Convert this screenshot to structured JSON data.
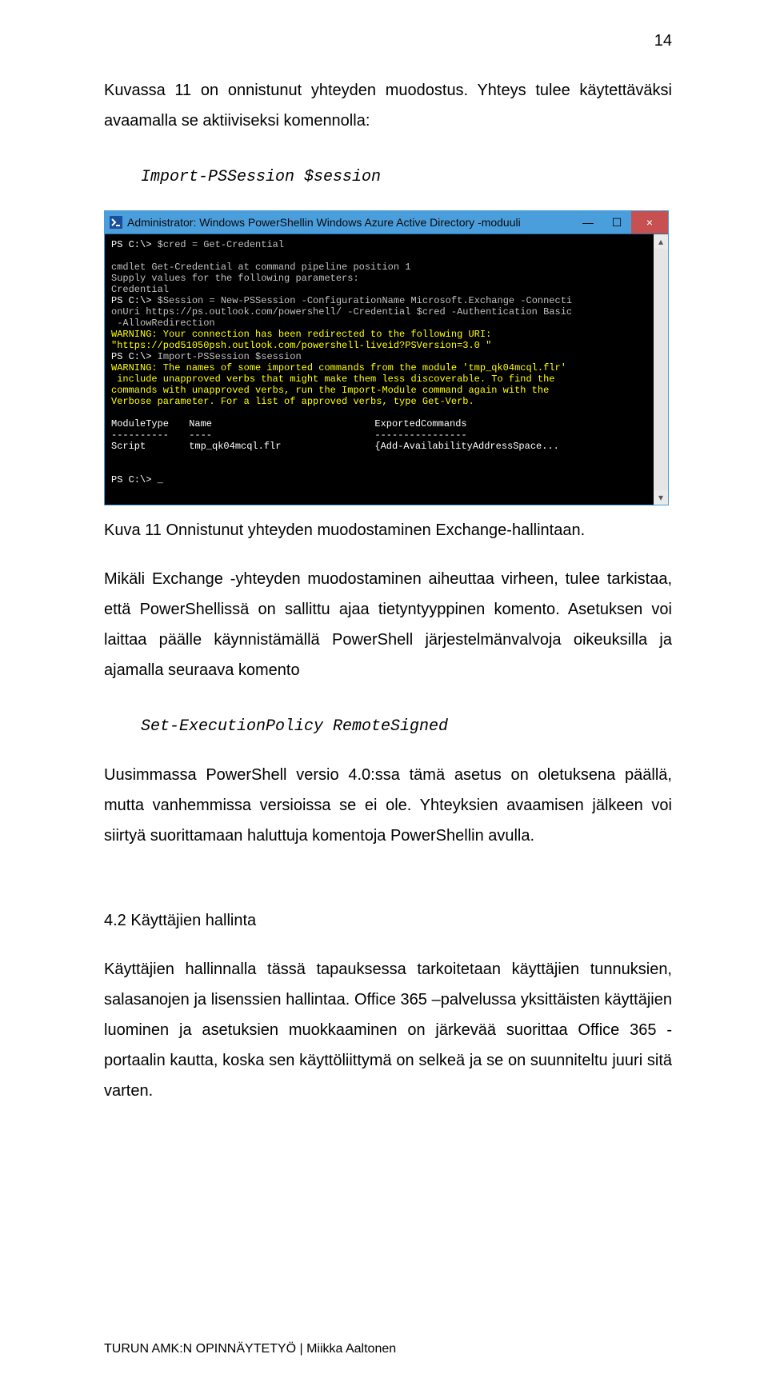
{
  "page_number": "14",
  "para1": "Kuvassa 11 on onnistunut yhteyden muodostus. Yhteys tulee käytettäväksi avaamalla se aktiiviseksi komennolla:",
  "code1": "Import-PSSession $session",
  "caption": "Kuva 11 Onnistunut yhteyden muodostaminen Exchange-hallintaan.",
  "para2": "Mikäli Exchange -yhteyden muodostaminen aiheuttaa virheen, tulee tarkistaa, että PowerShellissä on sallittu ajaa tietyntyyppinen komento. Asetuksen voi laittaa päälle käynnistämällä PowerShell järjestelmänvalvoja oikeuksilla ja ajamalla seuraava komento",
  "code2": "Set-ExecutionPolicy RemoteSigned",
  "para3": "Uusimmassa PowerShell versio 4.0:ssa tämä asetus on oletuksena päällä, mutta vanhemmissa versioissa se ei ole. Yhteyksien avaamisen jälkeen voi siirtyä suorittamaan haluttuja komentoja PowerShellin avulla.",
  "heading": "4.2 Käyttäjien hallinta",
  "para4": "Käyttäjien hallinnalla tässä tapauksessa tarkoitetaan käyttäjien tunnuksien, salasanojen ja lisenssien hallintaa. Office 365 –palvelussa yksittäisten käyttäjien luominen ja asetuksien muokkaaminen on järkevää suorittaa Office 365 -portaalin kautta, koska sen käyttöliittymä on selkeä ja se on suunniteltu juuri sitä varten.",
  "footer": "TURUN AMK:N OPINNÄYTETYÖ | Miikka Aaltonen",
  "terminal": {
    "title": "Administrator: Windows PowerShellin Windows Azure Active Directory -moduuli",
    "minimize": "—",
    "maximize": "☐",
    "close": "×",
    "sb_up": "▴",
    "sb_down": "▾",
    "l_prompt": "PS C:\\>",
    "l_cred": " $cred = Get-Credential",
    "l_cmdlet": "cmdlet Get-Credential at command pipeline position 1",
    "l_supply": "Supply values for the following parameters:",
    "l_cred_label": "Credential",
    "l_sess": " $Session = New-PSSession -ConfigurationName Microsoft.Exchange -Connecti",
    "l_onUri": "onUri https://ps.outlook.com/powershell/ -Credential $cred -Authentication Basic",
    "l_allow": " -AllowRedirection",
    "l_warn1": "WARNING: Your connection has been redirected to the following URI:",
    "l_warn2": "\"https://pod51050psh.outlook.com/powershell-liveid?PSVersion=3.0 \"",
    "l_import": " Import-PSSession $session",
    "l_warn3a": "WARNING: The names of some imported commands from the module 'tmp_qk04mcql.flr'",
    "l_warn3b": " include unapproved verbs that might make them less discoverable. To find the",
    "l_warn3c": "commands with unapproved verbs, run the Import-Module command again with the",
    "l_warn3d": "Verbose parameter. For a list of approved verbs, type Get-Verb.",
    "hdr_type": "ModuleType",
    "hdr_name": "Name",
    "hdr_exp": "ExportedCommands",
    "sep_type": "----------",
    "sep_name": "----",
    "sep_exp": "----------------",
    "row_type": "Script",
    "row_name": "tmp_qk04mcql.flr",
    "row_exp": "{Add-AvailabilityAddressSpace...",
    "cursor": " _"
  },
  "chart_data": {
    "type": "table",
    "title": "PowerShell Import-PSSession output",
    "columns": [
      "ModuleType",
      "Name",
      "ExportedCommands"
    ],
    "rows": [
      [
        "Script",
        "tmp_qk04mcql.flr",
        "{Add-AvailabilityAddressSpace..."
      ]
    ]
  }
}
